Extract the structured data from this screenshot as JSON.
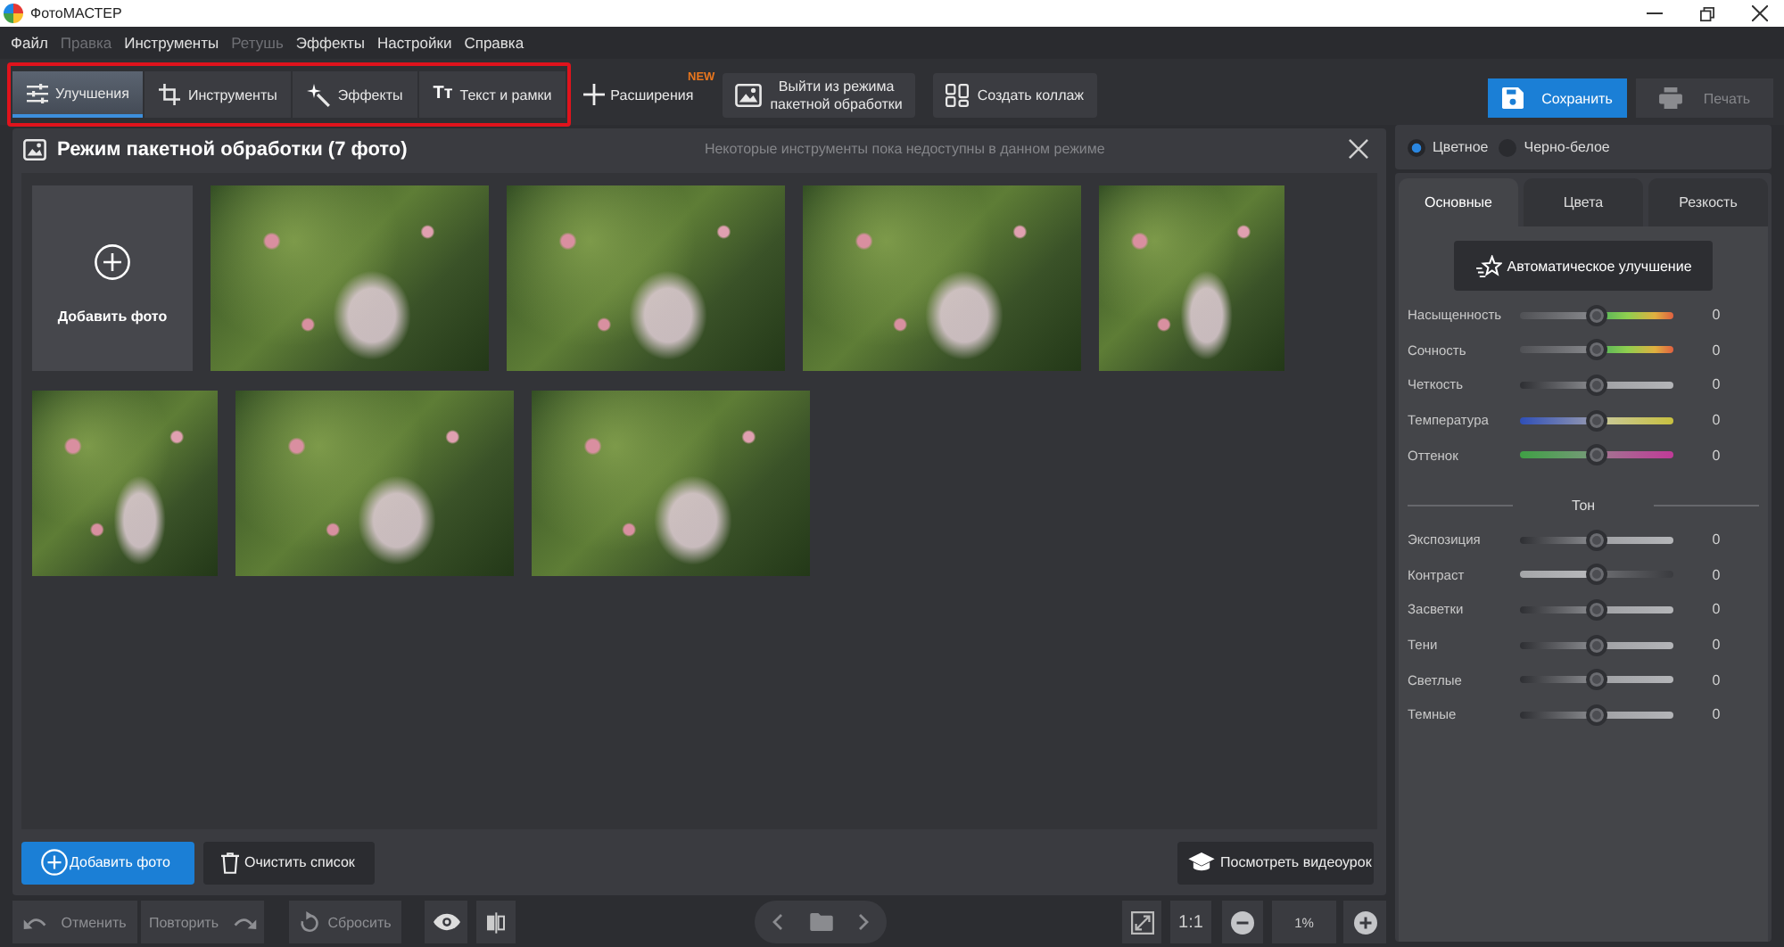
{
  "window": {
    "title": "ФотоМАСТЕР"
  },
  "menu": [
    {
      "label": "Файл",
      "disabled": false
    },
    {
      "label": "Правка",
      "disabled": true
    },
    {
      "label": "Инструменты",
      "disabled": false
    },
    {
      "label": "Ретушь",
      "disabled": true
    },
    {
      "label": "Эффекты",
      "disabled": false
    },
    {
      "label": "Настройки",
      "disabled": false
    },
    {
      "label": "Справка",
      "disabled": false
    }
  ],
  "toolbar": {
    "highlighted": true,
    "tabs": [
      {
        "label": "Улучшения",
        "selected": true
      },
      {
        "label": "Инструменты",
        "selected": false
      },
      {
        "label": "Эффекты",
        "selected": false
      },
      {
        "label": "Текст и рамки",
        "selected": false,
        "glyph": "Tт"
      }
    ],
    "extensions": {
      "label": "Расширения",
      "badge": "NEW"
    },
    "exit_batch": {
      "label_lines": [
        "Выйти из режима",
        "пакетной обработки"
      ]
    },
    "collage": {
      "label": "Создать коллаж"
    },
    "save": {
      "label": "Сохранить"
    },
    "print": {
      "label": "Печать",
      "disabled": true
    }
  },
  "batch_panel": {
    "title": "Режим пакетной обработки (7 фото)",
    "hint": "Некоторые инструменты пока недоступны в данном режиме",
    "add_tile": {
      "label": "Добавить фото"
    },
    "photos": [
      {
        "kind": "landscape"
      },
      {
        "kind": "landscape"
      },
      {
        "kind": "landscape"
      },
      {
        "kind": "portrait"
      },
      {
        "kind": "portrait"
      },
      {
        "kind": "landscape"
      },
      {
        "kind": "landscape"
      }
    ],
    "add_button": {
      "label": "Добавить фото"
    },
    "clear_button": {
      "label": "Очистить список"
    },
    "tutorial_button": {
      "label": "Посмотреть видеоурок"
    }
  },
  "bottom_bar": {
    "undo": {
      "label": "Отменить",
      "disabled": true
    },
    "redo": {
      "label": "Повторить",
      "disabled": true
    },
    "reset": {
      "label": "Сбросить",
      "disabled": true
    },
    "actual_size": {
      "label": "1:1"
    },
    "zoom": {
      "value": "1%"
    }
  },
  "right_panel": {
    "color_mode": [
      {
        "label": "Цветное",
        "selected": true
      },
      {
        "label": "Черно-белое",
        "selected": false
      }
    ],
    "tabs": [
      {
        "label": "Основные",
        "selected": true
      },
      {
        "label": "Цвета",
        "selected": false
      },
      {
        "label": "Резкость",
        "selected": false
      }
    ],
    "auto_button": {
      "label": "Автоматическое улучшение"
    },
    "sliders": [
      {
        "label": "Насыщенность",
        "kind": "spectrum",
        "level": 0.5,
        "reading": "0"
      },
      {
        "label": "Сочность",
        "kind": "spectrum",
        "level": 0.5,
        "reading": "0"
      },
      {
        "label": "Четкость",
        "kind": "tone",
        "level": 0.5,
        "reading": "0"
      },
      {
        "label": "Температура",
        "kind": "temperature",
        "level": 0.5,
        "reading": "0"
      },
      {
        "label": "Оттенок",
        "kind": "tint",
        "level": 0.5,
        "reading": "0"
      }
    ],
    "tone": {
      "title": "Тон",
      "sliders": [
        {
          "label": "Экспозиция",
          "kind": "tone",
          "level": 0.5,
          "reading": "0"
        },
        {
          "label": "Контраст",
          "kind": "contrast",
          "level": 0.5,
          "reading": "0"
        },
        {
          "label": "Засветки",
          "kind": "tone",
          "level": 0.5,
          "reading": "0"
        },
        {
          "label": "Тени",
          "kind": "tone",
          "level": 0.5,
          "reading": "0"
        },
        {
          "label": "Светлые",
          "kind": "tone",
          "level": 0.5,
          "reading": "0"
        },
        {
          "label": "Темные",
          "kind": "tone",
          "level": 0.5,
          "reading": "0"
        }
      ]
    }
  }
}
